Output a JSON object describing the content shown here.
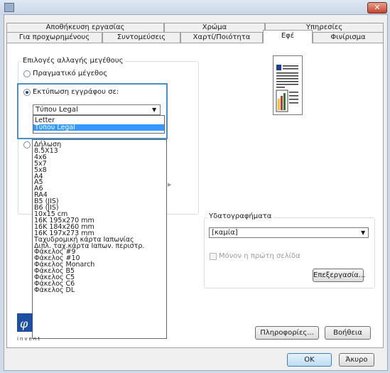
{
  "window": {
    "close_glyph": "✕",
    "app_icon": "printer-icon"
  },
  "tabs_row1": [
    "Αποθήκευση εργασίας",
    "Χρώμα",
    "Υπηρεσίες"
  ],
  "tabs_row2": [
    "Για προχωρημένους",
    "Συντομεύσεις",
    "Χαρτί/Ποιότητα",
    "Εφέ",
    "Φινίρισμα"
  ],
  "active_tab": "Εφέ",
  "resize_group": {
    "title": "Επιλογές αλλαγής μεγέθους",
    "option_actual": "Πραγματικό μέγεθος",
    "option_print_on": "Εκτύπωση εγγράφου σε:",
    "selected_paper": "Τύπου Legal",
    "option_percent": "Δήλωση"
  },
  "paper_dropdown_top": [
    "Letter",
    "Τύπου Legal"
  ],
  "paper_dropdown_selected": "Τύπου Legal",
  "paper_dropdown_list": [
    "Δήλωση",
    "8.5X13",
    "4x6",
    "5x7",
    "5x8",
    "A4",
    "A5",
    "A6",
    "RA4",
    "B5 (JIS)",
    "B6 (JIS)",
    "10x15 cm",
    "16K 195x270 mm",
    "16K 184x260 mm",
    "16K 197x273 mm",
    "Ταχυδρομική κάρτα Ιαπωνίας",
    "Διπλ. ταχ.κάρτα Ιαπων. περιστρ.",
    "Φάκελος #9",
    "Φάκελος #10",
    "Φάκελος Monarch",
    "Φάκελος B5",
    "Φάκελος C5",
    "Φάκελος C6",
    "Φάκελος DL"
  ],
  "watermarks": {
    "title": "Υδατογραφήματα",
    "selected": "[καμία]",
    "first_page_only": "Μόνον η πρώτη σελίδα",
    "edit_button": "Επεξεργασία..."
  },
  "footer": {
    "info_button": "Πληροφορίες...",
    "help_button": "Βοήθεια",
    "ok_button": "OK",
    "cancel_button": "Άκυρο"
  },
  "logo": {
    "text": "invent"
  },
  "colors": {
    "highlight_border": "#4a90c4",
    "selection": "#3399ff"
  }
}
